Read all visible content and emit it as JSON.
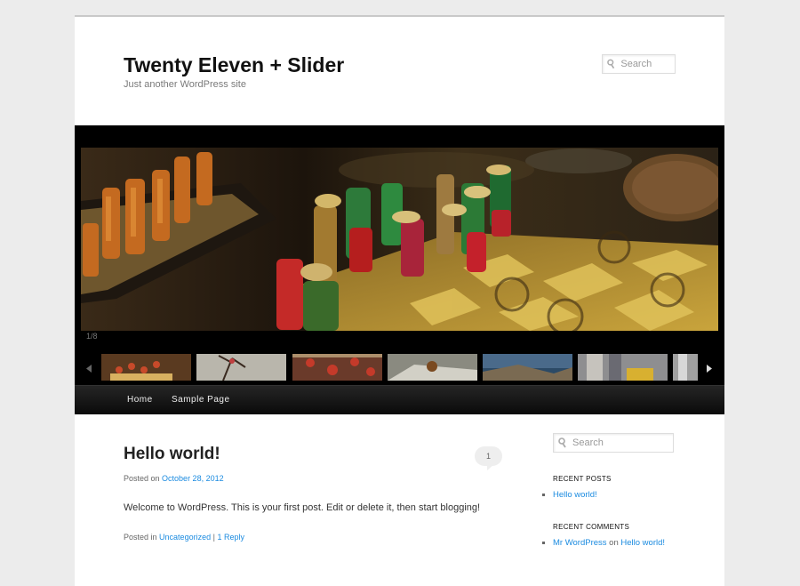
{
  "site": {
    "title": "Twenty Eleven + Slider",
    "description": "Just another WordPress site"
  },
  "header_search": {
    "placeholder": "Search"
  },
  "slider": {
    "counter": "1/8",
    "prev_icon": "chevron-left-icon",
    "next_icon": "chevron-right-icon"
  },
  "nav": {
    "items": [
      {
        "label": "Home"
      },
      {
        "label": "Sample Page"
      }
    ]
  },
  "post": {
    "title": "Hello world!",
    "posted_on_label": "Posted on",
    "date": "October 28, 2012",
    "comment_count": "1",
    "content": "Welcome to WordPress. This is your first post. Edit or delete it, then start blogging!",
    "posted_in_label": "Posted in",
    "category": "Uncategorized",
    "separator": "|",
    "reply_link": "1 Reply"
  },
  "sidebar": {
    "search_placeholder": "Search",
    "recent_posts_title": "RECENT POSTS",
    "recent_posts": [
      "Hello world!"
    ],
    "recent_comments_title": "RECENT COMMENTS",
    "recent_comment": {
      "author": "Mr WordPress",
      "on": "on",
      "post": "Hello world!"
    }
  },
  "colors": {
    "link": "#1b8be0",
    "background": "#ececec",
    "nav_bar": "#1a1a1a"
  }
}
